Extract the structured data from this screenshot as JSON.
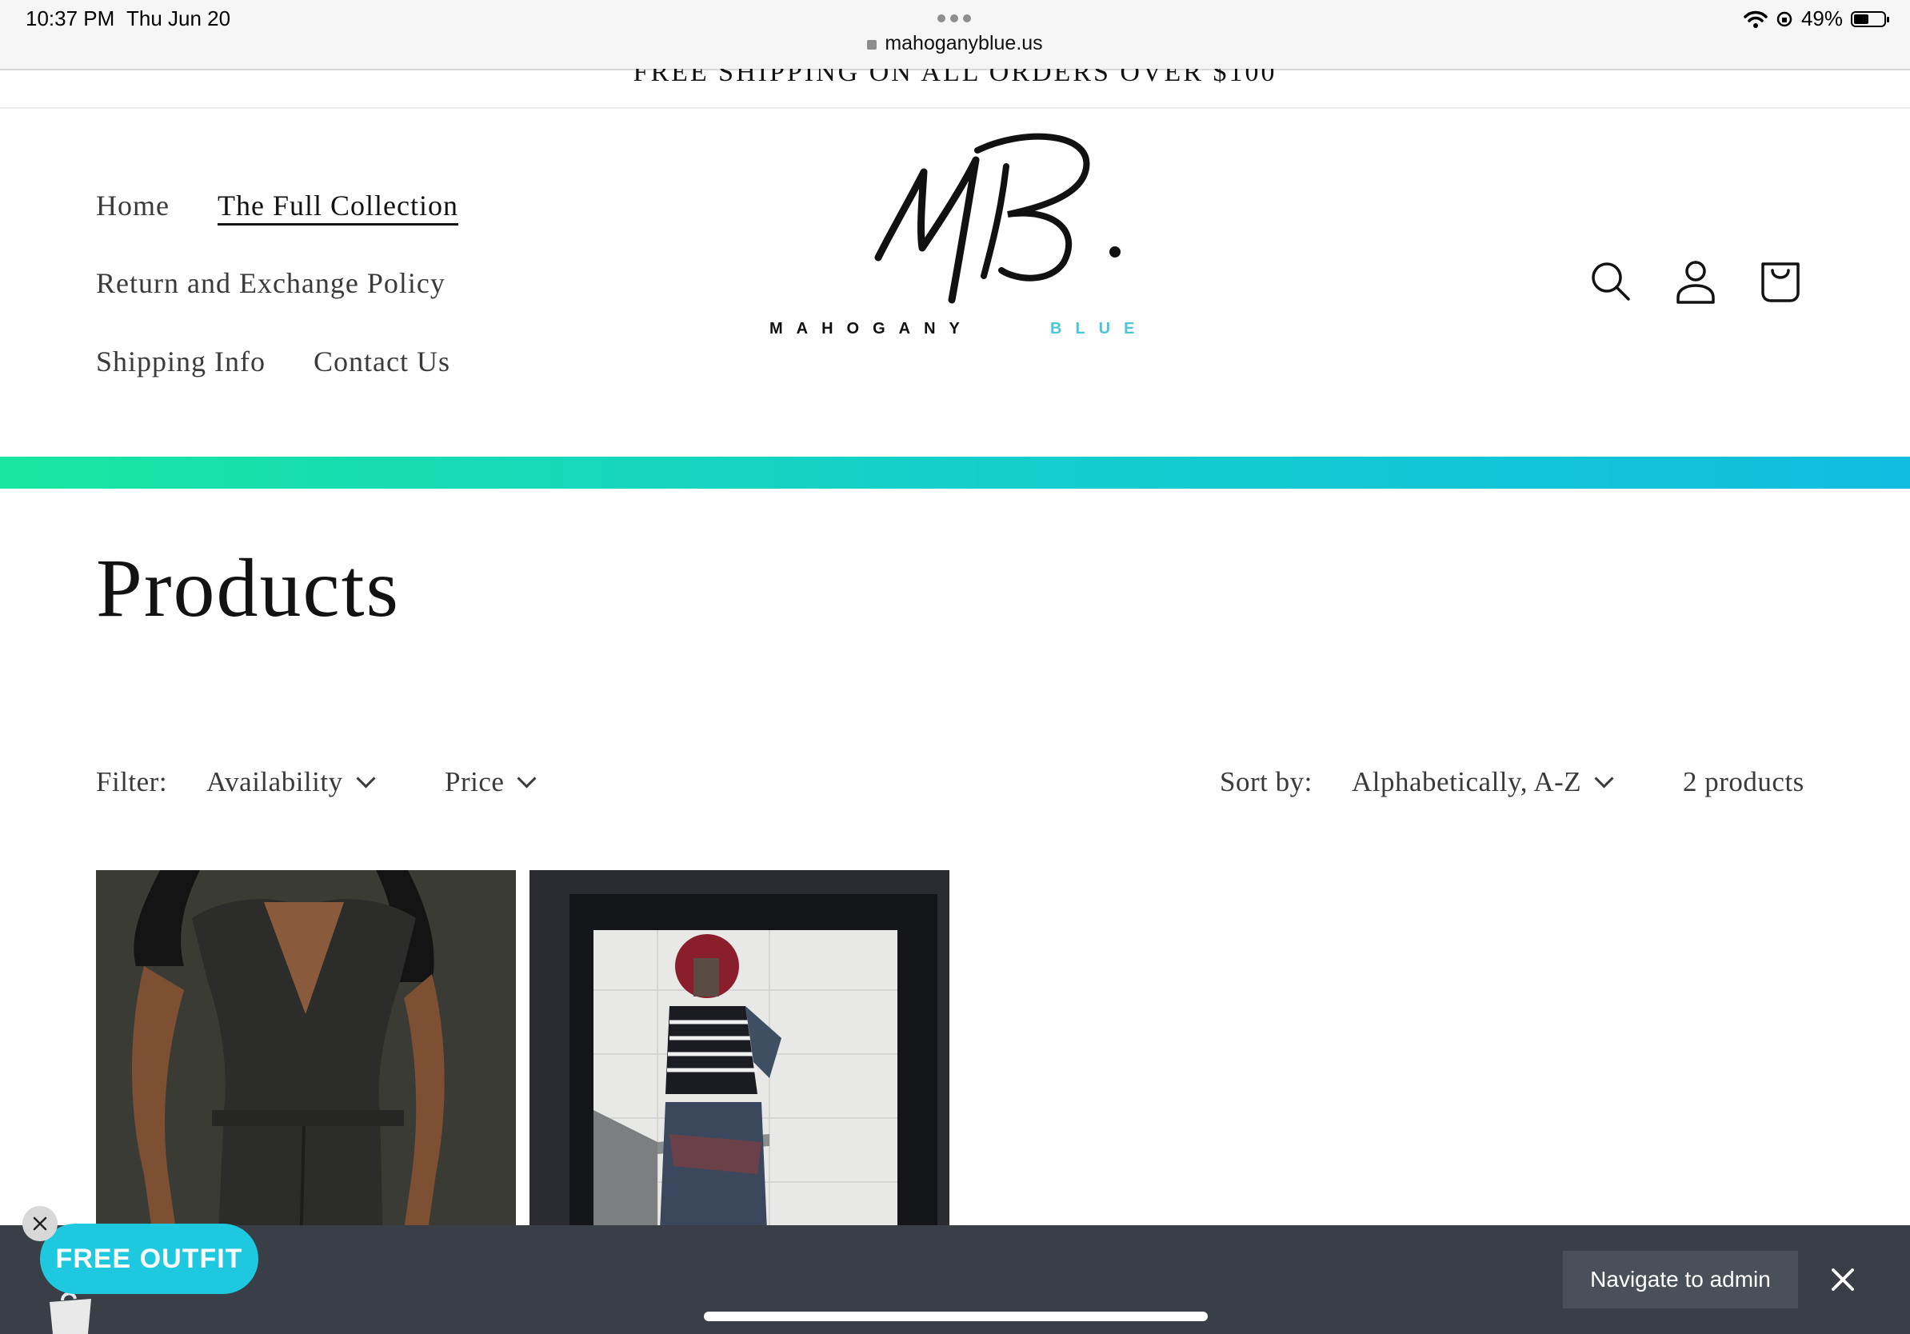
{
  "status_bar": {
    "time": "10:37 PM",
    "date": "Thu Jun 20",
    "url": "mahoganyblue.us",
    "battery": "49%",
    "battery_level": 0.49
  },
  "announcement": {
    "text": "FREE SHIPPING ON ALL ORDERS OVER $100"
  },
  "nav": {
    "home": "Home",
    "full_collection": "The Full Collection",
    "return_policy": "Return and Exchange Policy",
    "shipping": "Shipping Info",
    "contact": "Contact Us"
  },
  "logo": {
    "monogram": "MB.",
    "brand_left": "MAHOGANY",
    "brand_right": "BLUE"
  },
  "header_icons": [
    "search-icon",
    "account-icon",
    "cart-icon"
  ],
  "page": {
    "title": "Products"
  },
  "filters": {
    "label": "Filter:",
    "availability": "Availability",
    "price": "Price",
    "sort_label": "Sort by:",
    "sort_value": "Alphabetically, A-Z",
    "count": "2 products"
  },
  "products": [
    {
      "image": "dark grey corset dress"
    },
    {
      "image": "mirror selfie in striped top"
    }
  ],
  "promo": {
    "label": "FREE OUTFIT"
  },
  "admin_bar": {
    "button": "Navigate to admin"
  },
  "colors": {
    "accent_gradient_start": "#19e6a0",
    "accent_gradient_end": "#11bde0",
    "promo": "#1ec9e0",
    "admin_bar": "#3a3f47"
  }
}
